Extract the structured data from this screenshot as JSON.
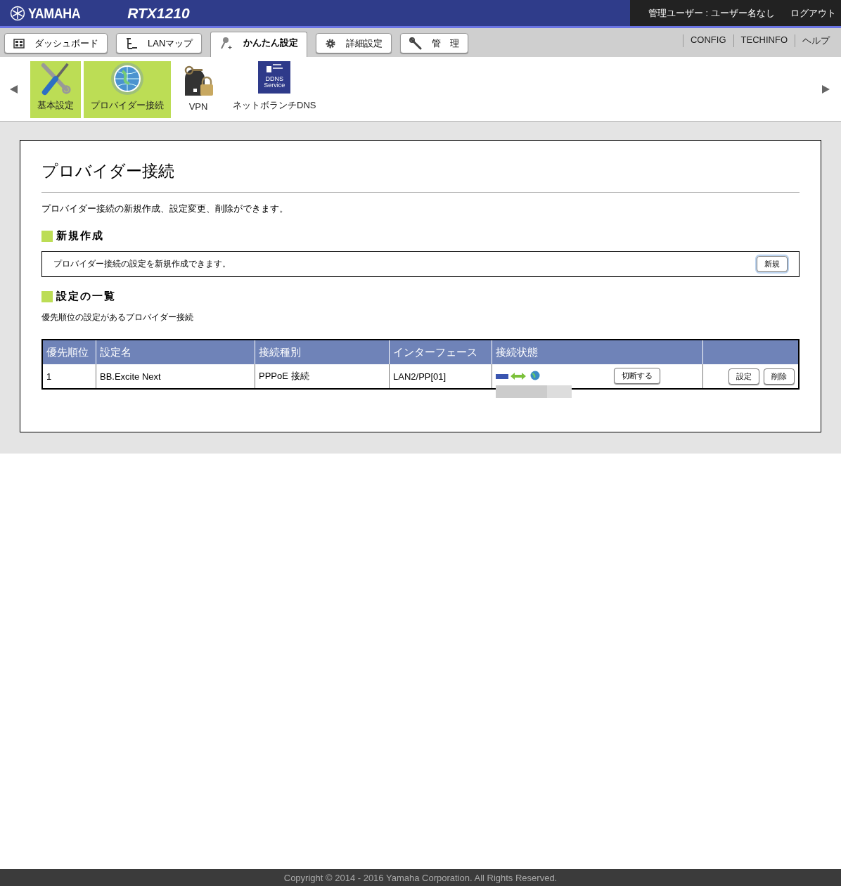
{
  "header": {
    "logo": "YAMAHA",
    "model": "RTX1210",
    "user": "管理ユーザー : ユーザー名なし",
    "logout": "ログアウト"
  },
  "main_tabs": [
    {
      "label": "ダッシュボード",
      "selected": false
    },
    {
      "label": "LANマップ",
      "selected": false
    },
    {
      "label": "かんたん設定",
      "selected": true
    },
    {
      "label": "詳細設定",
      "selected": false
    },
    {
      "label": "管　理",
      "selected": false
    }
  ],
  "utility_links": [
    "CONFIG",
    "TECHINFO",
    "ヘルプ"
  ],
  "sub_menu": [
    {
      "label": "基本設定",
      "selected": true
    },
    {
      "label": "プロバイダー接続",
      "selected": true
    },
    {
      "label": "VPN",
      "selected": false
    },
    {
      "label": "ネットボランチDNS",
      "logo_text": [
        "DDNS",
        "Service"
      ],
      "selected": false
    }
  ],
  "page": {
    "title": "プロバイダー接続",
    "description": "プロバイダー接続の新規作成、設定変更、削除ができます。",
    "new_section": {
      "heading": "新規作成",
      "text": "プロバイダー接続の設定を新規作成できます。",
      "button": "新規"
    },
    "list_section": {
      "heading": "設定の一覧",
      "caption": "優先順位の設定があるプロバイダー接続",
      "table": {
        "columns": [
          "優先順位",
          "設定名",
          "接続種別",
          "インターフェース",
          "接続状態"
        ],
        "rows": [
          {
            "priority": "1",
            "name": "BB.Excite Next",
            "type": "PPPoE 接続",
            "interface": "LAN2/PP[01]",
            "status_button": "切断する",
            "actions": [
              "設定",
              "削除"
            ]
          }
        ]
      }
    }
  },
  "footer": "Copyright © 2014 - 2016 Yamaha Corporation. All Rights Reserved."
}
